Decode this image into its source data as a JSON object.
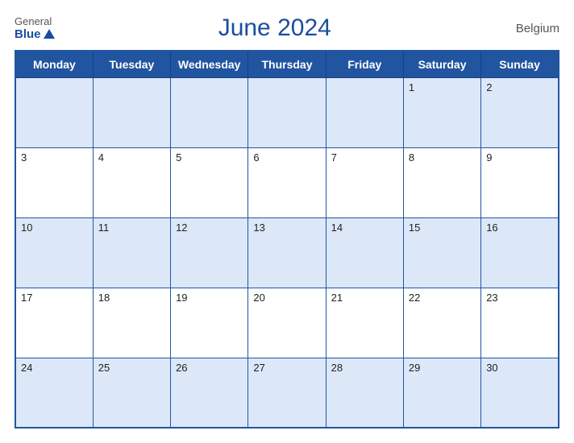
{
  "header": {
    "logo_general": "General",
    "logo_blue": "Blue",
    "title": "June 2024",
    "country": "Belgium"
  },
  "calendar": {
    "days_of_week": [
      "Monday",
      "Tuesday",
      "Wednesday",
      "Thursday",
      "Friday",
      "Saturday",
      "Sunday"
    ],
    "weeks": [
      [
        null,
        null,
        null,
        null,
        null,
        1,
        2
      ],
      [
        3,
        4,
        5,
        6,
        7,
        8,
        9
      ],
      [
        10,
        11,
        12,
        13,
        14,
        15,
        16
      ],
      [
        17,
        18,
        19,
        20,
        21,
        22,
        23
      ],
      [
        24,
        25,
        26,
        27,
        28,
        29,
        30
      ]
    ]
  }
}
